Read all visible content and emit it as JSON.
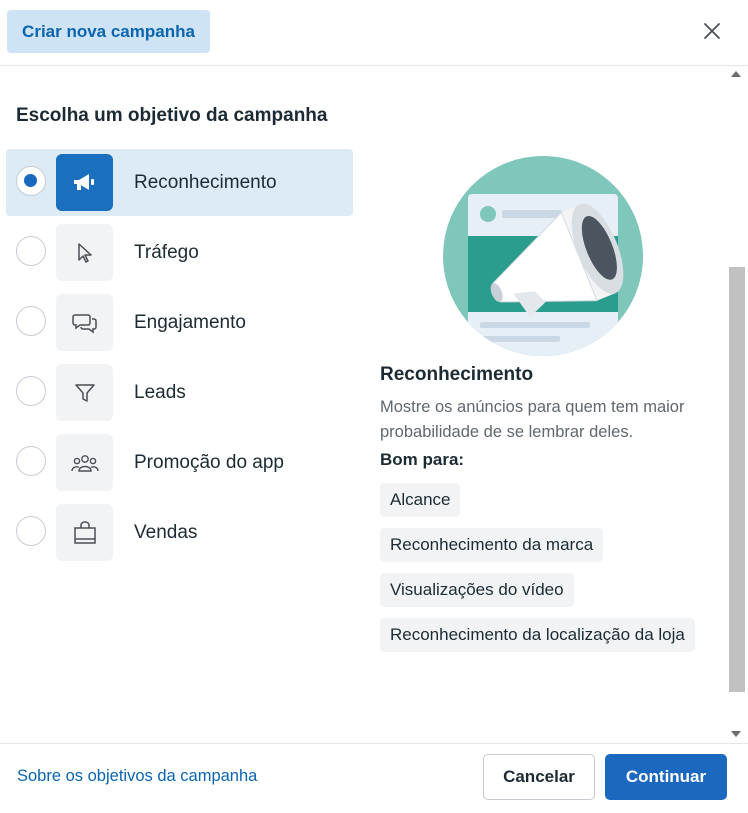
{
  "header": {
    "tab_label": "Criar nova campanha"
  },
  "section_title": "Escolha um objetivo da campanha",
  "objectives": [
    {
      "label": "Reconhecimento",
      "icon": "megaphone-icon",
      "selected": true
    },
    {
      "label": "Tráfego",
      "icon": "cursor-icon",
      "selected": false
    },
    {
      "label": "Engajamento",
      "icon": "chat-bubbles-icon",
      "selected": false
    },
    {
      "label": "Leads",
      "icon": "funnel-icon",
      "selected": false
    },
    {
      "label": "Promoção do app",
      "icon": "people-icon",
      "selected": false
    },
    {
      "label": "Vendas",
      "icon": "shopping-bag-icon",
      "selected": false
    }
  ],
  "detail": {
    "title": "Reconhecimento",
    "description": "Mostre os anúncios para quem tem maior probabilidade de se lembrar deles.",
    "good_for_label": "Bom para:",
    "tags": [
      "Alcance",
      "Reconhecimento da marca",
      "Visualizações do vídeo",
      "Reconhecimento da localização da loja"
    ]
  },
  "footer": {
    "link": "Sobre os objetivos da campanha",
    "cancel_label": "Cancelar",
    "continue_label": "Continuar"
  },
  "colors": {
    "accent": "#1a68c0",
    "selected_bg": "#ddebf7",
    "tab_bg": "#cfe3f6",
    "illustration_teal": "#7fc6bb"
  }
}
